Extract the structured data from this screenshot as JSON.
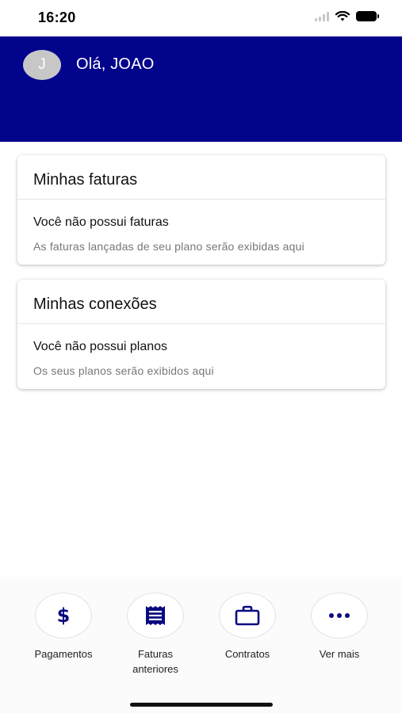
{
  "status_bar": {
    "time": "16:20"
  },
  "header": {
    "avatar_initial": "J",
    "greeting": "Olá, JOAO"
  },
  "cards": {
    "invoices": {
      "title": "Minhas faturas",
      "empty_title": "Você não possui faturas",
      "empty_subtitle": "As faturas lançadas de seu plano serão exibidas aqui"
    },
    "connections": {
      "title": "Minhas conexões",
      "empty_title": "Você não possui planos",
      "empty_subtitle": "Os seus planos serão exibidos aqui"
    }
  },
  "bottom_nav": {
    "items": [
      {
        "label": "Pagamentos",
        "icon": "dollar-icon"
      },
      {
        "label_line1": "Faturas",
        "label_line2": "anteriores",
        "icon": "receipt-icon"
      },
      {
        "label": "Contratos",
        "icon": "briefcase-icon"
      },
      {
        "label": "Ver mais",
        "icon": "more-dots-icon"
      }
    ]
  },
  "colors": {
    "brand": "#03048c",
    "icon": "#0a0a80"
  }
}
